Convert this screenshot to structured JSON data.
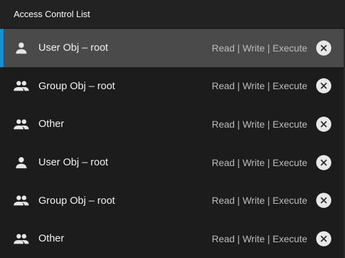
{
  "panel": {
    "title": "Access Control List"
  },
  "entries": [
    {
      "type": "user",
      "icon": "person-icon",
      "label": "User Obj – root",
      "permissions": "Read | Write | Execute",
      "selected": true
    },
    {
      "type": "group",
      "icon": "group-icon",
      "label": "Group Obj – root",
      "permissions": "Read | Write | Execute",
      "selected": false
    },
    {
      "type": "other",
      "icon": "group-icon",
      "label": "Other",
      "permissions": "Read | Write | Execute",
      "selected": false
    },
    {
      "type": "user",
      "icon": "person-icon",
      "label": "User Obj – root",
      "permissions": "Read | Write | Execute",
      "selected": false
    },
    {
      "type": "group",
      "icon": "group-icon",
      "label": "Group Obj – root",
      "permissions": "Read | Write | Execute",
      "selected": false
    },
    {
      "type": "other",
      "icon": "group-icon",
      "label": "Other",
      "permissions": "Read | Write | Execute",
      "selected": false
    }
  ],
  "colors": {
    "accent": "#1a8fd0",
    "selected_row": "#4a4a4a",
    "background": "#1c1c1c"
  }
}
